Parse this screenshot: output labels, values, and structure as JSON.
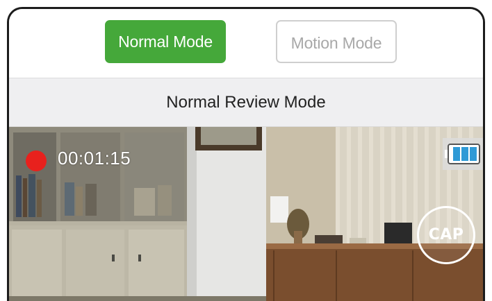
{
  "mode_tabs": {
    "normal_label": "Normal Mode",
    "motion_label": "Motion Mode",
    "active": "Normal Mode"
  },
  "review_banner": {
    "title": "Normal Review Mode"
  },
  "recording": {
    "time": "00:01:15"
  },
  "capture": {
    "label": "CAP"
  },
  "colors": {
    "active_tab": "#45a83a",
    "record_dot": "#e8211d",
    "battery_fill": "#2f9ad6"
  },
  "icons": {
    "record": "record-dot-icon",
    "battery": "battery-icon",
    "capture": "capture-button"
  }
}
